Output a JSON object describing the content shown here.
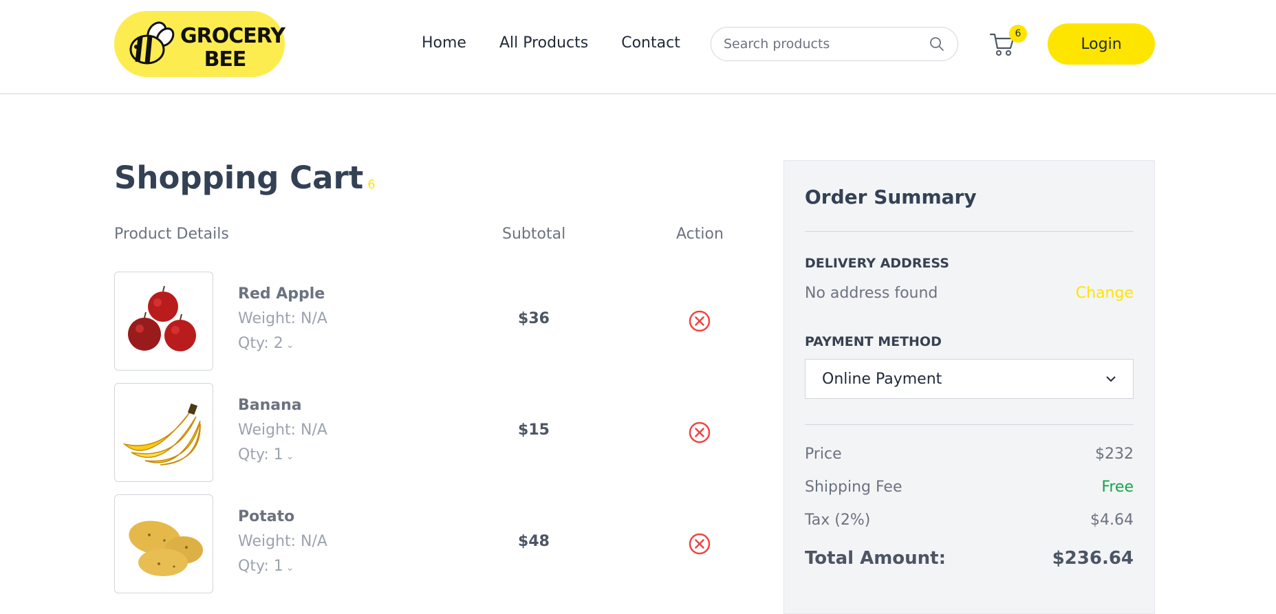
{
  "brand": {
    "line1": "GROCERY",
    "line2": "BEE",
    "accent": "#fde500",
    "logo_bg": "#fdec50"
  },
  "nav": {
    "links": [
      "Home",
      "All Products",
      "Contact"
    ]
  },
  "search": {
    "placeholder": "Search products",
    "value": ""
  },
  "cart": {
    "count": "6"
  },
  "login_label": "Login",
  "cart_page": {
    "title": "Shopping Cart",
    "count": "6",
    "headers": {
      "product": "Product Details",
      "subtotal": "Subtotal",
      "action": "Action"
    },
    "items": [
      {
        "name": "Red Apple",
        "weight": "Weight: N/A",
        "qty": "Qty: 2",
        "subtotal": "$36",
        "image": "red-apple-image"
      },
      {
        "name": "Banana",
        "weight": "Weight: N/A",
        "qty": "Qty: 1",
        "subtotal": "$15",
        "image": "banana-image"
      },
      {
        "name": "Potato",
        "weight": "Weight: N/A",
        "qty": "Qty: 1",
        "subtotal": "$48",
        "image": "potato-image"
      }
    ]
  },
  "summary": {
    "title": "Order Summary",
    "delivery_label": "DELIVERY ADDRESS",
    "address": "No address found",
    "change_label": "Change",
    "payment_label": "PAYMENT METHOD",
    "payment_value": "Online Payment",
    "price_label": "Price",
    "price_value": "$232",
    "shipping_label": "Shipping Fee",
    "shipping_value": "Free",
    "tax_label": "Tax (2%)",
    "tax_value": "$4.64",
    "total_label": "Total Amount:",
    "total_value": "$236.64"
  }
}
